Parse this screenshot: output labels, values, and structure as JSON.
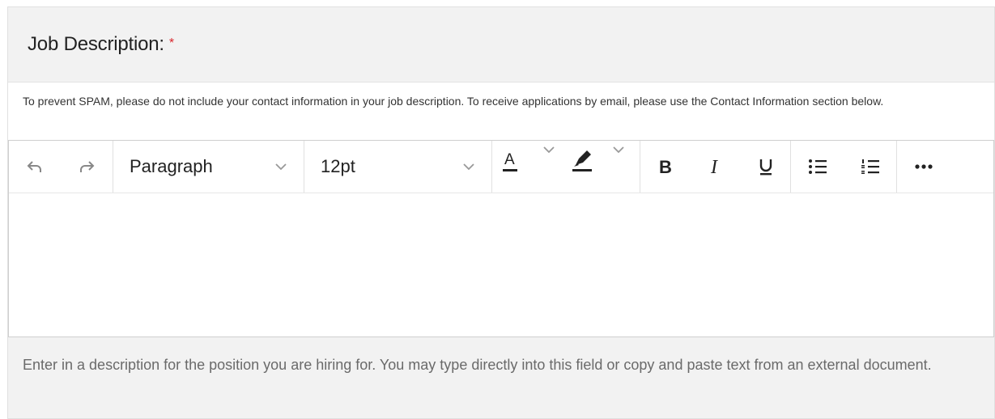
{
  "field": {
    "title": "Job Description:",
    "required_marker": "*",
    "notice": "To prevent SPAM, please do not include your contact information in your job description. To receive applications by email, please use the Contact Information section below.",
    "help_text": "Enter in a description for the position you are hiring for. You may type directly into this field or copy and paste text from an external document."
  },
  "toolbar": {
    "block_format": "Paragraph",
    "font_size": "12pt",
    "icons": [
      "undo-icon",
      "redo-icon",
      "text-color-icon",
      "highlight-icon",
      "bold-icon",
      "italic-icon",
      "underline-icon",
      "bullet-list-icon",
      "numbered-list-icon",
      "more-icon"
    ]
  },
  "colors": {
    "required": "#d9262c",
    "panel": "#f2f2f2"
  }
}
